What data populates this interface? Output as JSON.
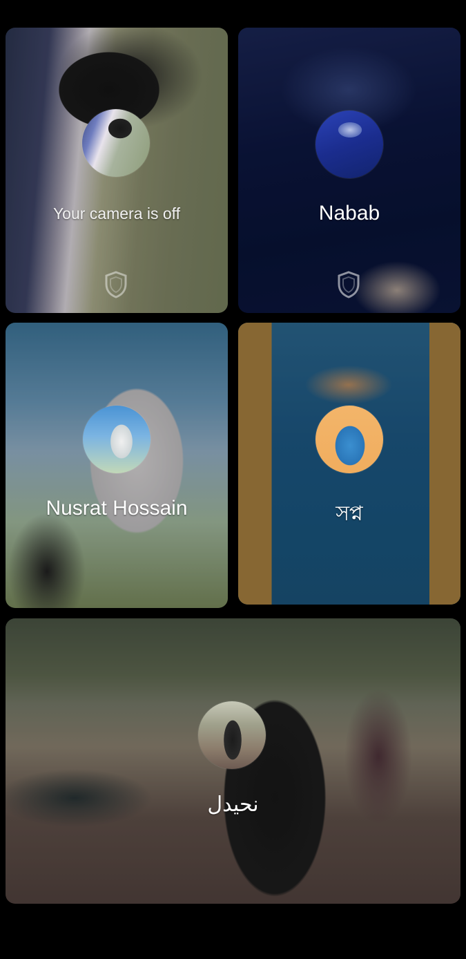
{
  "tiles": [
    {
      "name": "Your camera is off",
      "avatar": "self-avatar",
      "shield_icon": "shield-icon"
    },
    {
      "name": "Nabab",
      "avatar": "nabab-avatar",
      "shield_icon": "shield-icon"
    },
    {
      "name": "Nusrat Hossain",
      "avatar": "nusrat-avatar"
    },
    {
      "name": "সপ্ন",
      "avatar": "sopno-avatar"
    },
    {
      "name": "نحيدل",
      "avatar": "nahidal-avatar"
    }
  ]
}
